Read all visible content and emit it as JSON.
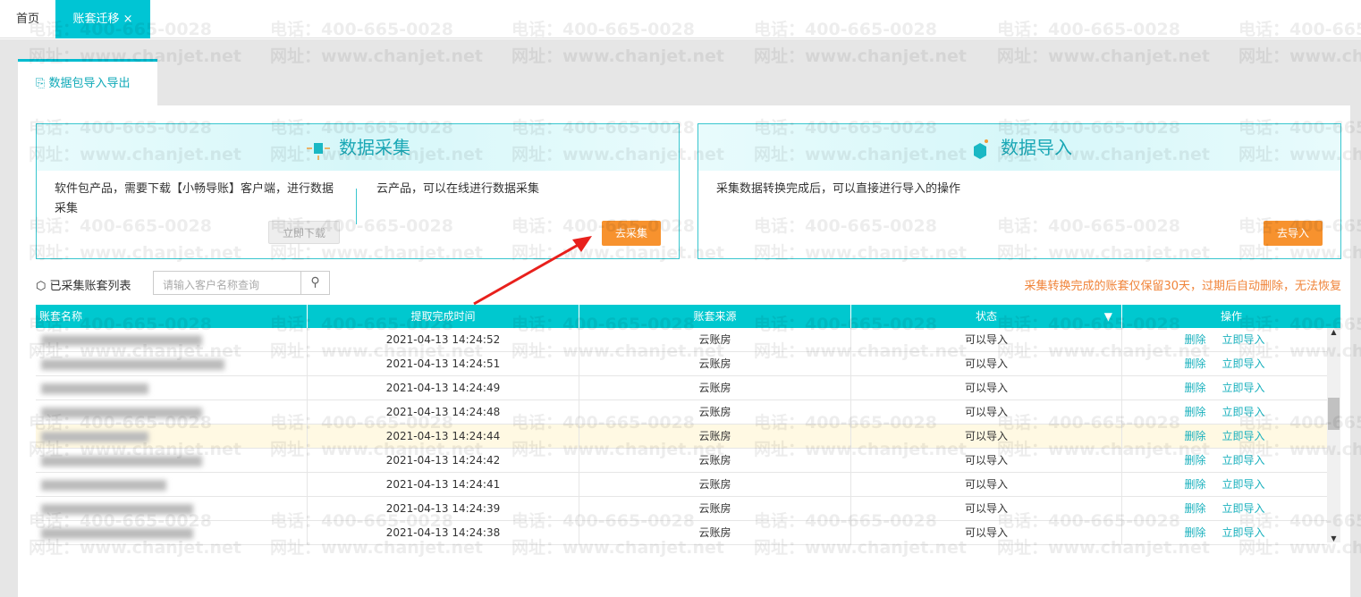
{
  "tabs": {
    "home": "首页",
    "active": "账套迁移",
    "close": "×"
  },
  "page_tab": {
    "icon": "export-icon",
    "label": "数据包导入导出"
  },
  "collect_card": {
    "title": "数据采集",
    "left_text": "软件包产品，需要下载【小畅导账】客户端，进行数据采集",
    "download_btn": "立即下载",
    "right_text": "云产品，可以在线进行数据采集",
    "go_btn": "去采集"
  },
  "import_card": {
    "title": "数据导入",
    "text": "采集数据转换完成后，可以直接进行导入的操作",
    "go_btn": "去导入"
  },
  "list": {
    "title": "已采集账套列表",
    "search_placeholder": "请输入客户名称查询",
    "notice": "采集转换完成的账套仅保留30天，过期后自动删除，无法恢复"
  },
  "table": {
    "headers": [
      "账套名称",
      "提取完成时间",
      "账套来源",
      "状态",
      "操作"
    ],
    "rows": [
      {
        "time": "2021-04-13 14:24:52",
        "source": "云账房",
        "status": "可以导入"
      },
      {
        "time": "2021-04-13 14:24:51",
        "source": "云账房",
        "status": "可以导入"
      },
      {
        "time": "2021-04-13 14:24:49",
        "source": "云账房",
        "status": "可以导入"
      },
      {
        "time": "2021-04-13 14:24:48",
        "source": "云账房",
        "status": "可以导入"
      },
      {
        "time": "2021-04-13 14:24:44",
        "source": "云账房",
        "status": "可以导入"
      },
      {
        "time": "2021-04-13 14:24:42",
        "source": "云账房",
        "status": "可以导入"
      },
      {
        "time": "2021-04-13 14:24:41",
        "source": "云账房",
        "status": "可以导入"
      },
      {
        "time": "2021-04-13 14:24:39",
        "source": "云账房",
        "status": "可以导入"
      },
      {
        "time": "2021-04-13 14:24:38",
        "source": "云账房",
        "status": "可以导入"
      }
    ],
    "delete": "删除",
    "import": "立即导入"
  },
  "watermark": {
    "phone": "电话：400-665-0028",
    "site": "网址：www.chanjet.net"
  },
  "colors": {
    "accent": "#00c8cf",
    "orange": "#f7922e",
    "arrow": "#e8201c"
  }
}
